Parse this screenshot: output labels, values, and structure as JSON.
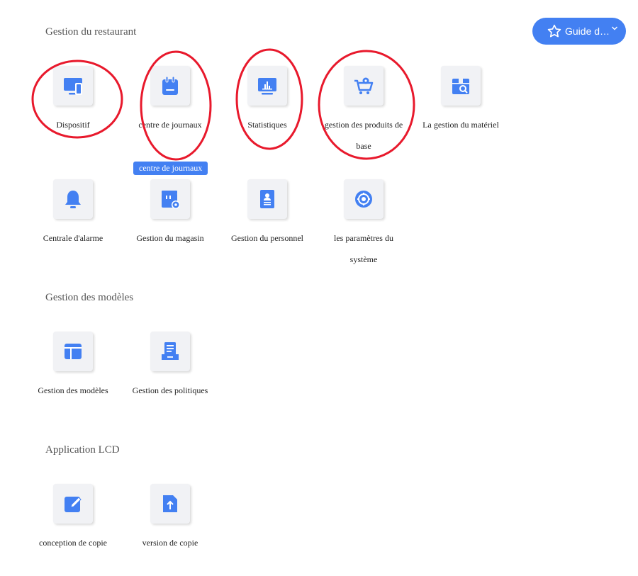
{
  "guide": {
    "label": "Guide d…",
    "icon": "star-icon"
  },
  "accent_color": "#4380f2",
  "annotation_color": "#e8192c",
  "sections": {
    "restaurant": {
      "title": "Gestion du restaurant",
      "apps": [
        {
          "label": "Dispositif",
          "icon": "device-icon"
        },
        {
          "label": "centre de journaux",
          "icon": "notebook-icon"
        },
        {
          "label": "Statistiques",
          "icon": "statistics-icon"
        },
        {
          "label": "gestion des produits de base",
          "icon": "cart-icon"
        },
        {
          "label": "La gestion du matériel",
          "icon": "material-search-icon"
        },
        {
          "label": "Centrale d'alarme",
          "icon": "bell-icon"
        },
        {
          "label": "Gestion du magasin",
          "icon": "store-settings-icon"
        },
        {
          "label": "Gestion du personnel",
          "icon": "personnel-icon"
        },
        {
          "label": "les paramètres du système",
          "icon": "settings-icon"
        }
      ]
    },
    "models": {
      "title": "Gestion des modèles",
      "apps": [
        {
          "label": "Gestion des modèles",
          "icon": "template-icon"
        },
        {
          "label": "Gestion des politiques",
          "icon": "policy-icon"
        }
      ]
    },
    "lcd": {
      "title": "Application LCD",
      "apps": [
        {
          "label": "conception de copie",
          "icon": "edit-icon"
        },
        {
          "label": "version de copie",
          "icon": "upload-icon"
        }
      ]
    }
  },
  "tooltip": {
    "text": "centre de journaux"
  }
}
